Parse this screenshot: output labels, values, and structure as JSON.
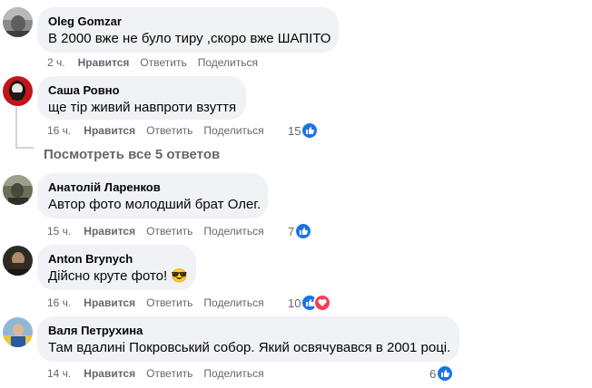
{
  "comments": [
    {
      "author": "Oleg Gomzar",
      "text": "В 2000 вже не було тиру ,скоро вже ШАПІТО",
      "time": "2 ч.",
      "like": "Нравится",
      "reply": "Ответить",
      "share": "Поделиться"
    },
    {
      "author": "Саша Ровно",
      "text": "ще тір живий навпроти взуття",
      "time": "16 ч.",
      "like": "Нравится",
      "reply": "Ответить",
      "share": "Поделиться",
      "reaction_count": "15"
    },
    {
      "author": "Анатолій Ларенков",
      "text": "Автор фото молодший брат Олег.",
      "time": "15 ч.",
      "like": "Нравится",
      "reply": "Ответить",
      "share": "Поделиться",
      "reaction_count": "7"
    },
    {
      "author": "Anton Brynych",
      "text": "Дійсно круте фото! 😎",
      "time": "16 ч.",
      "like": "Нравится",
      "reply": "Ответить",
      "share": "Поделиться",
      "reaction_count": "10"
    },
    {
      "author": "Валя Петрухина",
      "text": "Там вдалині Покровський собор. Який освячувався в 2001 році.",
      "time": "14 ч.",
      "like": "Нравится",
      "reply": "Ответить",
      "share": "Поделиться",
      "reaction_count": "6"
    }
  ],
  "view_replies": "Посмотреть все 5 ответов",
  "colors": {
    "like": "#1b74e4",
    "love": "#f33e58",
    "muted": "#65676b",
    "bubble": "#f0f2f5"
  }
}
